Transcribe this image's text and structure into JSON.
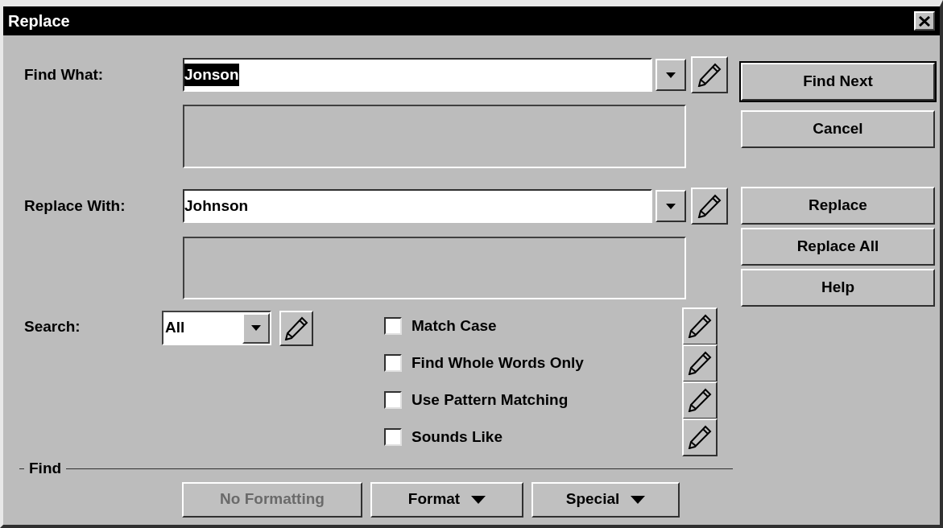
{
  "window": {
    "title": "Replace"
  },
  "find_what": {
    "label": "Find What:",
    "value": "Jonson",
    "value_selected": true
  },
  "replace_with": {
    "label": "Replace With:",
    "value": "Johnson",
    "value_selected": false
  },
  "search": {
    "label": "Search:",
    "value": "All"
  },
  "options": [
    {
      "label": "Match Case",
      "checked": false
    },
    {
      "label": "Find Whole Words Only",
      "checked": false
    },
    {
      "label": "Use Pattern Matching",
      "checked": false
    },
    {
      "label": "Sounds Like",
      "checked": false
    }
  ],
  "buttons": [
    {
      "label": "Find Next",
      "default": true
    },
    {
      "label": "Cancel",
      "default": false
    },
    {
      "label": "Replace",
      "default": false
    },
    {
      "label": "Replace All",
      "default": false
    },
    {
      "label": "Help",
      "default": false
    }
  ],
  "find_section": {
    "label": "Find",
    "buttons": [
      {
        "label": "No Formatting",
        "kind": "plain",
        "disabled": true
      },
      {
        "label": "Format",
        "kind": "menu",
        "disabled": false
      },
      {
        "label": "Special",
        "kind": "menu",
        "disabled": false
      }
    ]
  }
}
